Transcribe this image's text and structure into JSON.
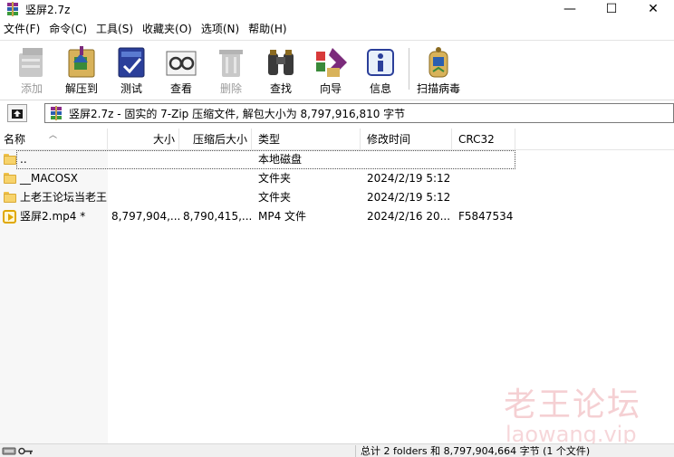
{
  "window": {
    "title": "竖屏2.7z",
    "minimize_glyph": "—",
    "maximize_glyph": "☐",
    "close_glyph": "✕"
  },
  "menu": [
    {
      "label": "文件(F)"
    },
    {
      "label": "命令(C)"
    },
    {
      "label": "工具(S)"
    },
    {
      "label": "收藏夹(O)"
    },
    {
      "label": "选项(N)"
    },
    {
      "label": "帮助(H)"
    }
  ],
  "toolbar": {
    "add": {
      "label": "添加",
      "icon": "add-files-icon",
      "disabled": true
    },
    "extract": {
      "label": "解压到",
      "icon": "extract-icon"
    },
    "test": {
      "label": "测试",
      "icon": "test-icon"
    },
    "view": {
      "label": "查看",
      "icon": "view-icon"
    },
    "delete": {
      "label": "删除",
      "icon": "delete-icon",
      "disabled": true
    },
    "find": {
      "label": "查找",
      "icon": "find-binoculars-icon"
    },
    "wizard": {
      "label": "向导",
      "icon": "wizard-icon"
    },
    "info": {
      "label": "信息",
      "icon": "info-icon"
    },
    "scan": {
      "label": "扫描病毒",
      "icon": "virus-scan-icon"
    }
  },
  "address": {
    "text": "竖屏2.7z - 固实的 7-Zip 压缩文件, 解包大小为 8,797,916,810 字节",
    "up_icon": "up-folder-icon"
  },
  "columns": {
    "name": "名称",
    "size": "大小",
    "packed": "压缩后大小",
    "type": "类型",
    "modified": "修改时间",
    "crc": "CRC32"
  },
  "files": [
    {
      "name": "..",
      "size": "",
      "packed": "",
      "type": "本地磁盘",
      "modified": "",
      "crc": "",
      "kind": "folder"
    },
    {
      "name": "__MACOSX",
      "size": "",
      "packed": "",
      "type": "文件夹",
      "modified": "2024/2/19 5:12",
      "crc": "",
      "kind": "folder"
    },
    {
      "name": "上老王论坛当老王",
      "size": "",
      "packed": "",
      "type": "文件夹",
      "modified": "2024/2/19 5:12",
      "crc": "",
      "kind": "folder"
    },
    {
      "name": "竖屏2.mp4 *",
      "size": "8,797,904,...",
      "packed": "8,790,415,...",
      "type": "MP4 文件",
      "modified": "2024/2/16 20...",
      "crc": "F5847534",
      "kind": "mp4"
    }
  ],
  "watermark": {
    "cn": "老王论坛",
    "en": "laowang.vip"
  },
  "status": {
    "text": "总计 2 folders 和 8,797,904,664 字节 (1 个文件)"
  },
  "colors": {
    "folder": "#f7d36b",
    "mp4": "#e0a800",
    "watermark": "#e27882"
  }
}
